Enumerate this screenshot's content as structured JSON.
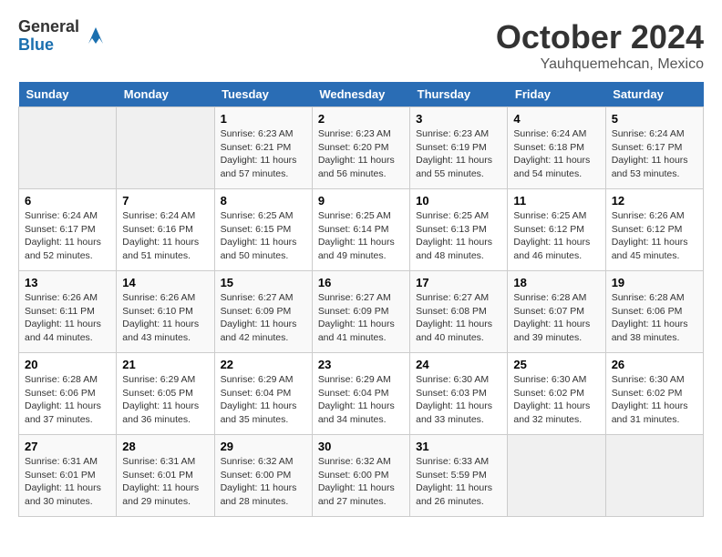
{
  "header": {
    "logo_general": "General",
    "logo_blue": "Blue",
    "month_year": "October 2024",
    "location": "Yauhquemehcan, Mexico"
  },
  "weekdays": [
    "Sunday",
    "Monday",
    "Tuesday",
    "Wednesday",
    "Thursday",
    "Friday",
    "Saturday"
  ],
  "weeks": [
    [
      {
        "day": "",
        "info": ""
      },
      {
        "day": "",
        "info": ""
      },
      {
        "day": "1",
        "sunrise": "Sunrise: 6:23 AM",
        "sunset": "Sunset: 6:21 PM",
        "daylight": "Daylight: 11 hours and 57 minutes."
      },
      {
        "day": "2",
        "sunrise": "Sunrise: 6:23 AM",
        "sunset": "Sunset: 6:20 PM",
        "daylight": "Daylight: 11 hours and 56 minutes."
      },
      {
        "day": "3",
        "sunrise": "Sunrise: 6:23 AM",
        "sunset": "Sunset: 6:19 PM",
        "daylight": "Daylight: 11 hours and 55 minutes."
      },
      {
        "day": "4",
        "sunrise": "Sunrise: 6:24 AM",
        "sunset": "Sunset: 6:18 PM",
        "daylight": "Daylight: 11 hours and 54 minutes."
      },
      {
        "day": "5",
        "sunrise": "Sunrise: 6:24 AM",
        "sunset": "Sunset: 6:17 PM",
        "daylight": "Daylight: 11 hours and 53 minutes."
      }
    ],
    [
      {
        "day": "6",
        "sunrise": "Sunrise: 6:24 AM",
        "sunset": "Sunset: 6:17 PM",
        "daylight": "Daylight: 11 hours and 52 minutes."
      },
      {
        "day": "7",
        "sunrise": "Sunrise: 6:24 AM",
        "sunset": "Sunset: 6:16 PM",
        "daylight": "Daylight: 11 hours and 51 minutes."
      },
      {
        "day": "8",
        "sunrise": "Sunrise: 6:25 AM",
        "sunset": "Sunset: 6:15 PM",
        "daylight": "Daylight: 11 hours and 50 minutes."
      },
      {
        "day": "9",
        "sunrise": "Sunrise: 6:25 AM",
        "sunset": "Sunset: 6:14 PM",
        "daylight": "Daylight: 11 hours and 49 minutes."
      },
      {
        "day": "10",
        "sunrise": "Sunrise: 6:25 AM",
        "sunset": "Sunset: 6:13 PM",
        "daylight": "Daylight: 11 hours and 48 minutes."
      },
      {
        "day": "11",
        "sunrise": "Sunrise: 6:25 AM",
        "sunset": "Sunset: 6:12 PM",
        "daylight": "Daylight: 11 hours and 46 minutes."
      },
      {
        "day": "12",
        "sunrise": "Sunrise: 6:26 AM",
        "sunset": "Sunset: 6:12 PM",
        "daylight": "Daylight: 11 hours and 45 minutes."
      }
    ],
    [
      {
        "day": "13",
        "sunrise": "Sunrise: 6:26 AM",
        "sunset": "Sunset: 6:11 PM",
        "daylight": "Daylight: 11 hours and 44 minutes."
      },
      {
        "day": "14",
        "sunrise": "Sunrise: 6:26 AM",
        "sunset": "Sunset: 6:10 PM",
        "daylight": "Daylight: 11 hours and 43 minutes."
      },
      {
        "day": "15",
        "sunrise": "Sunrise: 6:27 AM",
        "sunset": "Sunset: 6:09 PM",
        "daylight": "Daylight: 11 hours and 42 minutes."
      },
      {
        "day": "16",
        "sunrise": "Sunrise: 6:27 AM",
        "sunset": "Sunset: 6:09 PM",
        "daylight": "Daylight: 11 hours and 41 minutes."
      },
      {
        "day": "17",
        "sunrise": "Sunrise: 6:27 AM",
        "sunset": "Sunset: 6:08 PM",
        "daylight": "Daylight: 11 hours and 40 minutes."
      },
      {
        "day": "18",
        "sunrise": "Sunrise: 6:28 AM",
        "sunset": "Sunset: 6:07 PM",
        "daylight": "Daylight: 11 hours and 39 minutes."
      },
      {
        "day": "19",
        "sunrise": "Sunrise: 6:28 AM",
        "sunset": "Sunset: 6:06 PM",
        "daylight": "Daylight: 11 hours and 38 minutes."
      }
    ],
    [
      {
        "day": "20",
        "sunrise": "Sunrise: 6:28 AM",
        "sunset": "Sunset: 6:06 PM",
        "daylight": "Daylight: 11 hours and 37 minutes."
      },
      {
        "day": "21",
        "sunrise": "Sunrise: 6:29 AM",
        "sunset": "Sunset: 6:05 PM",
        "daylight": "Daylight: 11 hours and 36 minutes."
      },
      {
        "day": "22",
        "sunrise": "Sunrise: 6:29 AM",
        "sunset": "Sunset: 6:04 PM",
        "daylight": "Daylight: 11 hours and 35 minutes."
      },
      {
        "day": "23",
        "sunrise": "Sunrise: 6:29 AM",
        "sunset": "Sunset: 6:04 PM",
        "daylight": "Daylight: 11 hours and 34 minutes."
      },
      {
        "day": "24",
        "sunrise": "Sunrise: 6:30 AM",
        "sunset": "Sunset: 6:03 PM",
        "daylight": "Daylight: 11 hours and 33 minutes."
      },
      {
        "day": "25",
        "sunrise": "Sunrise: 6:30 AM",
        "sunset": "Sunset: 6:02 PM",
        "daylight": "Daylight: 11 hours and 32 minutes."
      },
      {
        "day": "26",
        "sunrise": "Sunrise: 6:30 AM",
        "sunset": "Sunset: 6:02 PM",
        "daylight": "Daylight: 11 hours and 31 minutes."
      }
    ],
    [
      {
        "day": "27",
        "sunrise": "Sunrise: 6:31 AM",
        "sunset": "Sunset: 6:01 PM",
        "daylight": "Daylight: 11 hours and 30 minutes."
      },
      {
        "day": "28",
        "sunrise": "Sunrise: 6:31 AM",
        "sunset": "Sunset: 6:01 PM",
        "daylight": "Daylight: 11 hours and 29 minutes."
      },
      {
        "day": "29",
        "sunrise": "Sunrise: 6:32 AM",
        "sunset": "Sunset: 6:00 PM",
        "daylight": "Daylight: 11 hours and 28 minutes."
      },
      {
        "day": "30",
        "sunrise": "Sunrise: 6:32 AM",
        "sunset": "Sunset: 6:00 PM",
        "daylight": "Daylight: 11 hours and 27 minutes."
      },
      {
        "day": "31",
        "sunrise": "Sunrise: 6:33 AM",
        "sunset": "Sunset: 5:59 PM",
        "daylight": "Daylight: 11 hours and 26 minutes."
      },
      {
        "day": "",
        "info": ""
      },
      {
        "day": "",
        "info": ""
      }
    ]
  ]
}
